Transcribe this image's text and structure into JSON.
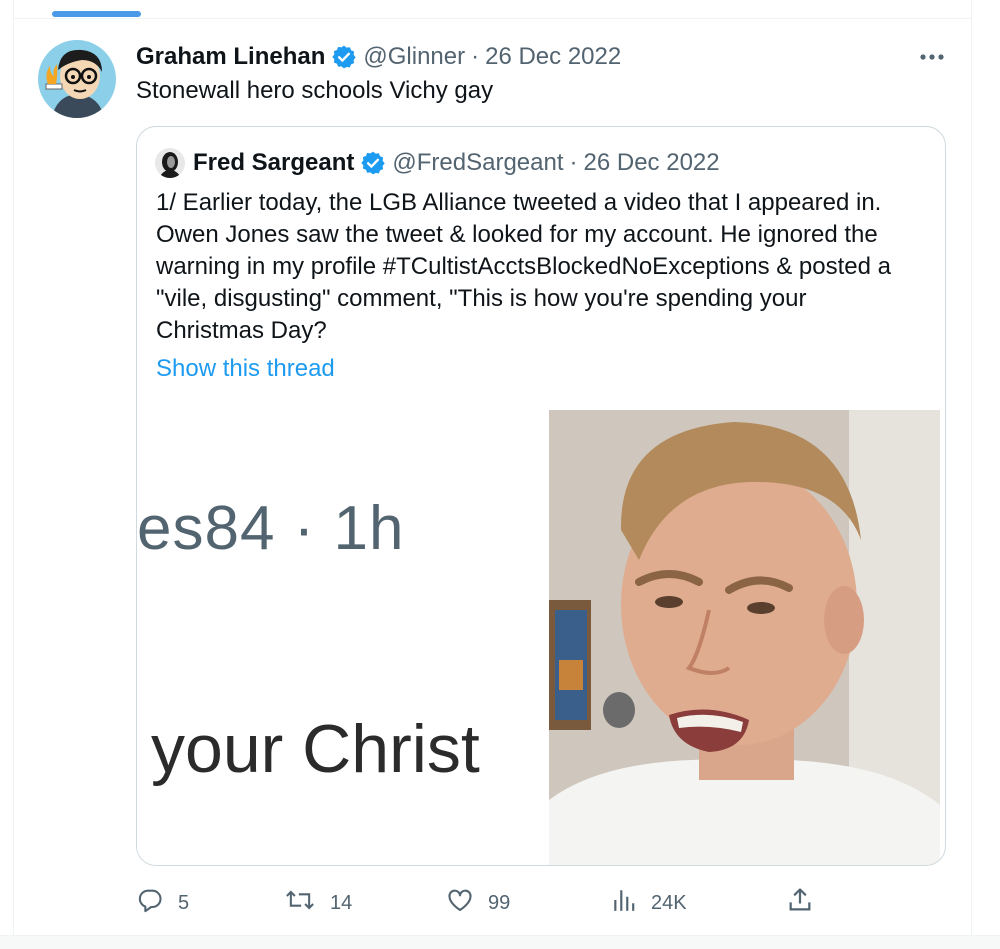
{
  "tweet": {
    "author_name": "Graham Linehan",
    "handle": "@Glinner",
    "separator": "·",
    "date": "26 Dec 2022",
    "text": "Stonewall hero schools Vichy gay"
  },
  "quote": {
    "author_name": "Fred Sargeant",
    "handle": "@FredSargeant",
    "separator": "·",
    "date": "26 Dec 2022",
    "text_lines": [
      "1/ Earlier today, the LGB Alliance tweeted a video that I appeared in.",
      "Owen Jones saw the tweet & looked for my account. He ignored the",
      "warning in my profile #TCultistAcctsBlockedNoExceptions & posted a",
      "\"vile, disgusting\" comment, \"This is how you're spending your",
      "Christmas Day?"
    ],
    "show_thread": "Show this thread",
    "media": {
      "zoomed_text_top": "es84 · 1h",
      "zoomed_text_bottom": "your Christ"
    }
  },
  "actions": {
    "replies": "5",
    "retweets": "14",
    "likes": "99",
    "views": "24K"
  },
  "icons": {
    "verified": "verified-badge-icon",
    "more": "more-icon",
    "reply": "reply-icon",
    "retweet": "retweet-icon",
    "like": "heart-icon",
    "views": "views-chart-icon",
    "share": "share-icon"
  },
  "colors": {
    "accent": "#1d9bf0",
    "muted": "#536471",
    "text": "#0f1419",
    "border": "#cfd9de"
  }
}
